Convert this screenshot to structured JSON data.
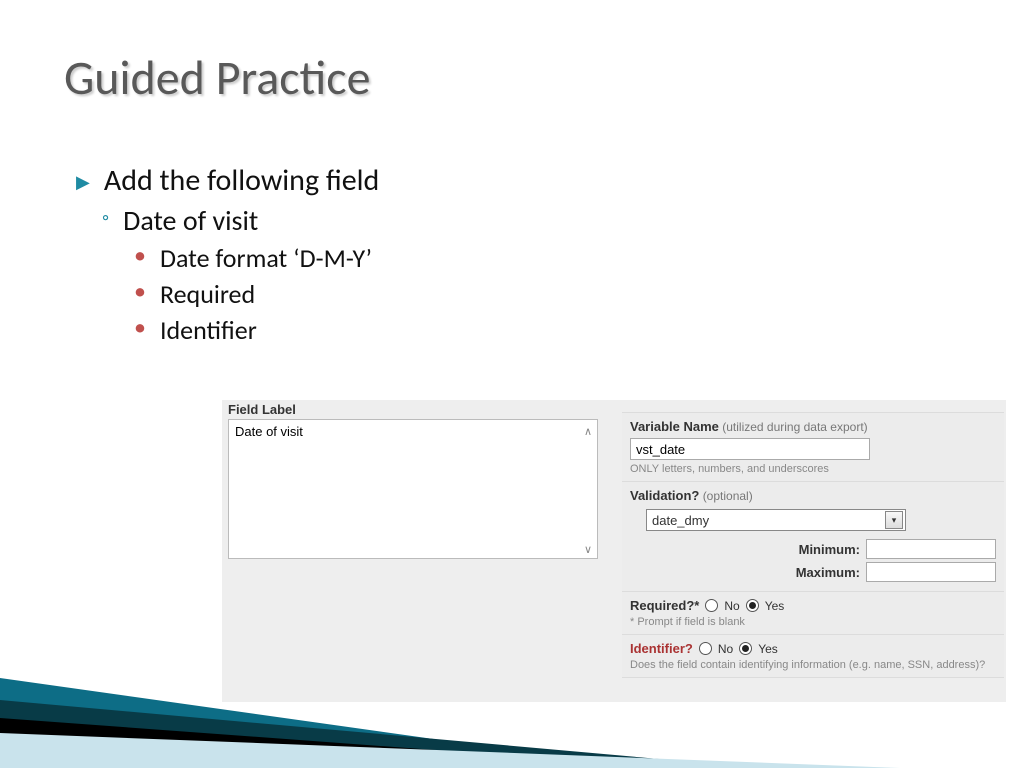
{
  "title": "Guided Practice",
  "bullets": {
    "main": "Add the following field",
    "sub": "Date of visit",
    "details": [
      "Date format ‘D-M-Y’",
      "Required",
      "Identifier"
    ]
  },
  "form": {
    "field_label_heading": "Field Label",
    "field_label_value": "Date of visit",
    "var_name_label": "Variable Name",
    "var_name_hint": "(utilized during data export)",
    "var_name_value": "vst_date",
    "var_name_fine": "ONLY letters, numbers, and underscores",
    "validation_label": "Validation?",
    "validation_hint": "(optional)",
    "validation_value": "date_dmy",
    "min_label": "Minimum:",
    "max_label": "Maximum:",
    "min_value": "",
    "max_value": "",
    "required_label": "Required?*",
    "required_fine": "* Prompt if field is blank",
    "identifier_label": "Identifier?",
    "identifier_fine": "Does the field contain identifying information (e.g. name, SSN, address)?",
    "opt_no": "No",
    "opt_yes": "Yes"
  }
}
